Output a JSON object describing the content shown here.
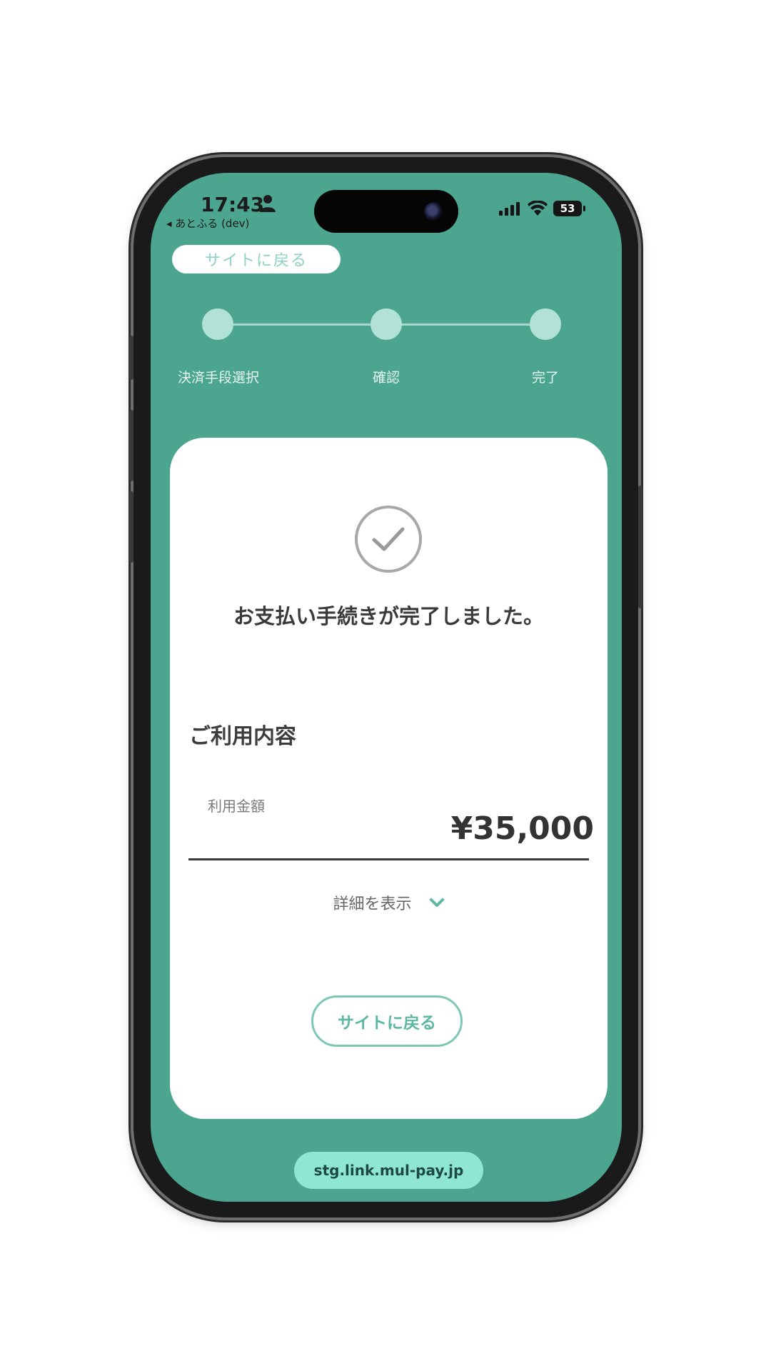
{
  "status_bar": {
    "time": "17:43",
    "back_app": "◂ あとふる (dev)",
    "battery": "53",
    "icons": [
      "person-icon",
      "signal-icon",
      "wifi-icon",
      "battery-icon"
    ]
  },
  "header": {
    "back_label": "サイトに戻る"
  },
  "stepper": {
    "steps": [
      {
        "label": "決済手段選択"
      },
      {
        "label": "確認"
      },
      {
        "label": "完了"
      }
    ]
  },
  "card": {
    "completion_message": "お支払い手続きが完了しました。",
    "section_title": "ご利用内容",
    "amount_label": "利用金額",
    "amount_value": "¥35,000",
    "details_label": "詳細を表示",
    "back_button_label": "サイトに戻る"
  },
  "browser": {
    "url": "stg.link.mul-pay.jp"
  },
  "colors": {
    "background": "#4ca58f",
    "accent": "#7cc8b5",
    "card": "#ffffff",
    "url_pill": "#8fe6d1"
  }
}
